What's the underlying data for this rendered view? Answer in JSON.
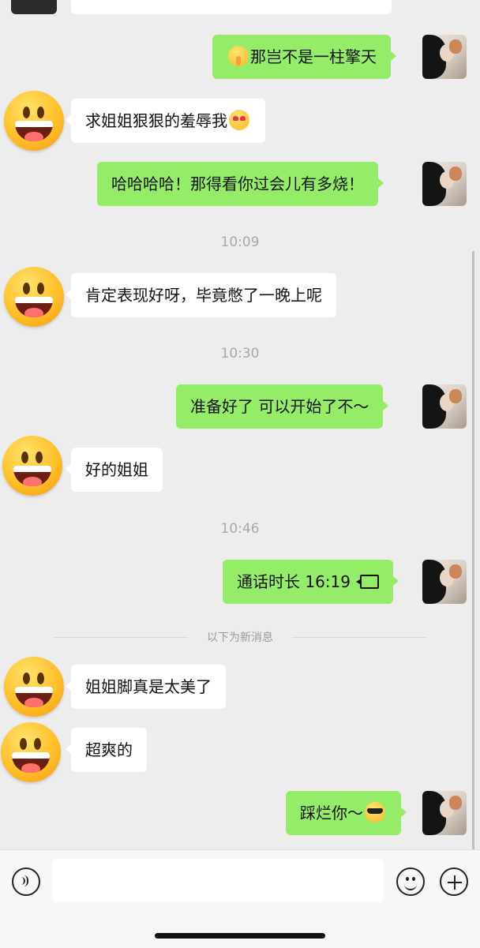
{
  "messages": [
    {
      "side": "out",
      "text": "那岂不是一柱擎天",
      "emoji_before": "shushing-face-emoji"
    },
    {
      "side": "in",
      "text": "求姐姐狠狠的羞辱我",
      "emoji_after": "heart-eyes-emoji"
    },
    {
      "side": "out",
      "text": "哈哈哈哈！那得看你过会儿有多烧！"
    },
    {
      "type": "time",
      "text": "10:09"
    },
    {
      "side": "in",
      "text": "肯定表现好呀，毕竟憋了一晚上呢"
    },
    {
      "type": "time",
      "text": "10:30"
    },
    {
      "side": "out",
      "text": "准备好了 可以开始了不～"
    },
    {
      "side": "in",
      "text": "好的姐姐"
    },
    {
      "type": "time",
      "text": "10:46"
    },
    {
      "side": "out",
      "text": "通话时长 16:19",
      "icon": "video-call-icon"
    },
    {
      "type": "divider",
      "text": "以下为新消息"
    },
    {
      "side": "in",
      "text": "姐姐脚真是太美了"
    },
    {
      "side": "in",
      "text": "超爽的"
    },
    {
      "side": "out",
      "text": "踩烂你～",
      "emoji_after": "sunglasses-emoji"
    }
  ],
  "input_bar": {
    "voice_icon": "voice-input-icon",
    "emoji_icon": "emoji-picker-icon",
    "plus_icon": "more-actions-icon",
    "text_value": ""
  },
  "colors": {
    "background": "#ededed",
    "bubble_out": "#95ec69",
    "bubble_in": "#ffffff",
    "timestamp": "#a8a8a8"
  }
}
